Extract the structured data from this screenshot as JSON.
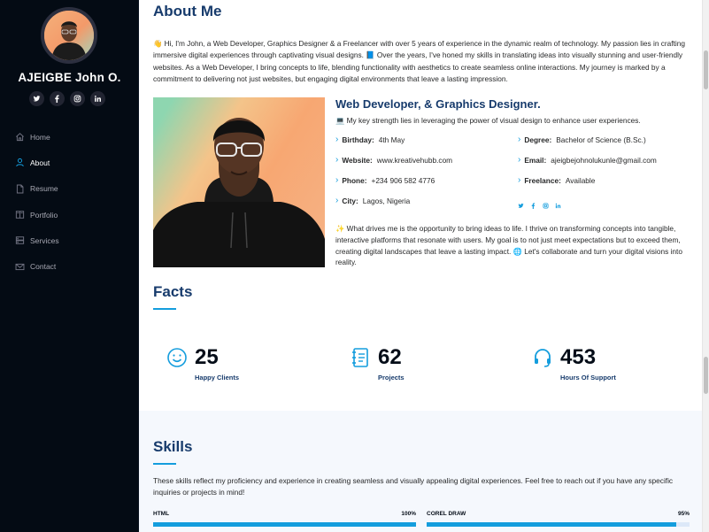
{
  "sidebar": {
    "name": "AJEIGBE John O.",
    "social": [
      "twitter",
      "facebook",
      "instagram",
      "linkedin"
    ],
    "items": [
      {
        "label": "Home",
        "icon": "home-icon",
        "active": false
      },
      {
        "label": "About",
        "icon": "person-icon",
        "active": true
      },
      {
        "label": "Resume",
        "icon": "file-icon",
        "active": false
      },
      {
        "label": "Portfolio",
        "icon": "book-icon",
        "active": false
      },
      {
        "label": "Services",
        "icon": "server-icon",
        "active": false
      },
      {
        "label": "Contact",
        "icon": "envelope-icon",
        "active": false
      }
    ]
  },
  "about": {
    "title": "About Me",
    "intro": "👋 Hi, I'm John, a Web Developer, Graphics Designer & a Freelancer with over 5 years of experience in the dynamic realm of technology. My passion lies in crafting immersive digital experiences through captivating visual designs. 📘 Over the years, I've honed my skills in translating ideas into visually stunning and user-friendly websites. As a Web Developer, I bring concepts to life, blending functionality with aesthetics to create seamless online interactions. My journey is marked by a commitment to delivering not just websites, but engaging digital environments that leave a lasting impression.",
    "role_title": "Web Developer, & Graphics Designer.",
    "role_sub": "💻 My key strength lies in leveraging the power of visual design to enhance user experiences.",
    "info": {
      "birthday_label": "Birthday:",
      "birthday": "4th May",
      "degree_label": "Degree:",
      "degree": "Bachelor of Science (B.Sc.)",
      "website_label": "Website:",
      "website": "www.kreativehubb.com",
      "email_label": "Email:",
      "email": "ajeigbejohnolukunle@gmail.com",
      "phone_label": "Phone:",
      "phone": "+234 906 582 4776",
      "freelance_label": "Freelance:",
      "freelance": "Available",
      "city_label": "City:",
      "city": "Lagos, Nigeria"
    },
    "outro": "✨ What drives me is the opportunity to bring ideas to life. I thrive on transforming concepts into tangible, interactive platforms that resonate with users. My goal is to not just meet expectations but to exceed them, creating digital landscapes that leave a lasting impact. 🌐 Let's collaborate and turn your digital visions into reality."
  },
  "facts": {
    "title": "Facts",
    "items": [
      {
        "value": "25",
        "label": "Happy Clients",
        "icon": "smiley-icon"
      },
      {
        "value": "62",
        "label": "Projects",
        "icon": "journal-icon"
      },
      {
        "value": "453",
        "label": "Hours Of Support",
        "icon": "headset-icon"
      }
    ]
  },
  "skills": {
    "title": "Skills",
    "text": "These skills reflect my proficiency and experience in creating seamless and visually appealing digital experiences. Feel free to reach out if you have any specific inquiries or projects in mind!",
    "items": [
      {
        "name": "HTML",
        "percent_label": "100%",
        "percent": 100
      },
      {
        "name": "COREL DRAW",
        "percent_label": "95%",
        "percent": 95
      }
    ]
  },
  "colors": {
    "accent": "#149ddd",
    "sidebar_bg": "#040b14",
    "heading": "#173b6c"
  }
}
